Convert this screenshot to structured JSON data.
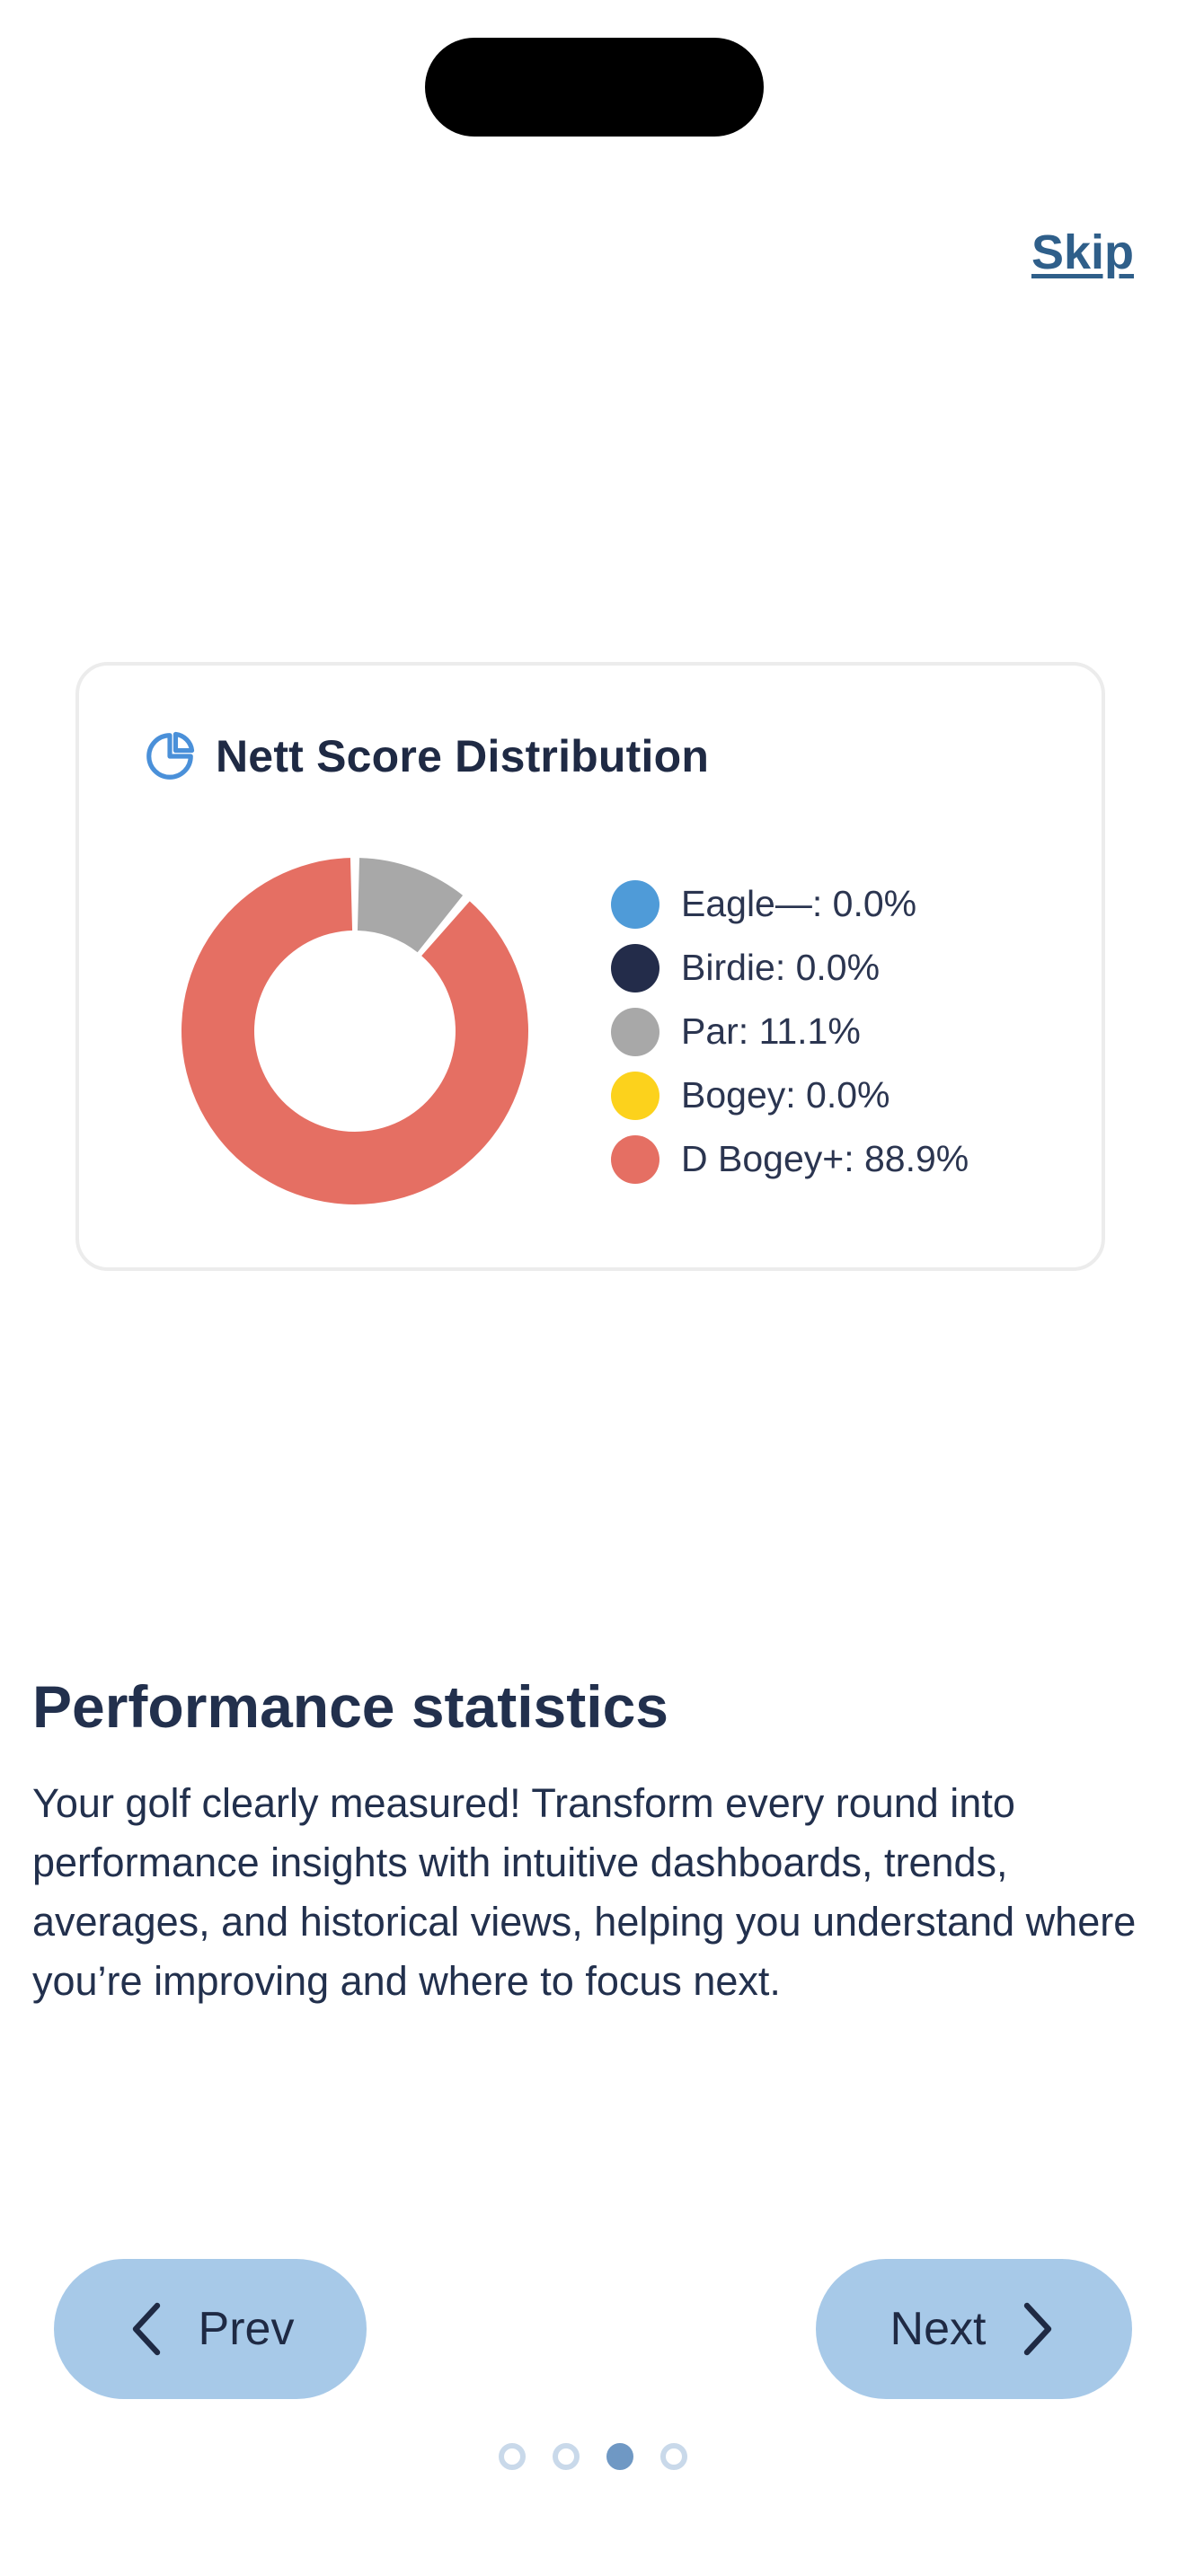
{
  "header": {
    "skip_label": "Skip"
  },
  "card": {
    "title": "Nett Score Distribution",
    "icon": "pie-chart-icon",
    "accent": "#4a90d9"
  },
  "chart_data": {
    "type": "pie",
    "title": "Nett Score Distribution",
    "categories": [
      "Eagle—",
      "Birdie",
      "Par",
      "Bogey",
      "D Bogey+"
    ],
    "values": [
      0.0,
      0.0,
      11.1,
      0.0,
      88.9
    ],
    "colors": [
      "#4f9bd8",
      "#232c4a",
      "#a8a8a8",
      "#fcd21c",
      "#e56f63"
    ],
    "legend_labels": [
      "Eagle—: 0.0%",
      "Birdie: 0.0%",
      "Par: 11.1%",
      "Bogey: 0.0%",
      "D Bogey+: 88.9%"
    ],
    "legend": "right"
  },
  "content": {
    "headline": "Performance statistics",
    "body": "Your golf clearly measured! Transform every round into performance insights with intuitive dashboards, trends, averages, and historical views, helping you understand where you’re improving and where to focus next."
  },
  "nav": {
    "prev_label": "Prev",
    "next_label": "Next",
    "page_count": 4,
    "active_page": 3,
    "button_color": "#a7c9e8",
    "dot_active_color": "#6f98c4"
  }
}
